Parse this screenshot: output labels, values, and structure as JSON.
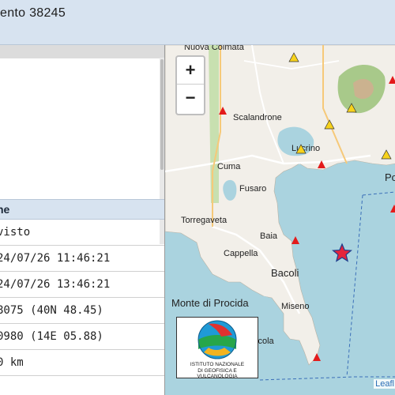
{
  "header": {
    "title": "ento 38245"
  },
  "table": {
    "header": "ne",
    "rows": [
      "visto",
      "24/07/26 11:46:21",
      "24/07/26 13:46:21",
      "8075 (40N 48.45)",
      "0980 (14E 05.88)",
      "0 km"
    ]
  },
  "map": {
    "zoom_in": "+",
    "zoom_out": "−",
    "labels": {
      "nuova_colmata": "Nuova Colmata",
      "scalandrone": "Scalandrone",
      "lucrino": "Lucrino",
      "cuma": "Cuma",
      "fusaro": "Fusaro",
      "torregaveta": "Torregaveta",
      "baia": "Baia",
      "cappella": "Cappella",
      "bacoli": "Bacoli",
      "monte_di_procida": "Monte di Procida",
      "miseno": "Miseno",
      "scola": "scola",
      "po": "Po"
    },
    "logo_line1": "ISTITUTO NAZIONALE",
    "logo_line2": "DI GEOFISICA E VULCANOLOGIA",
    "attribution": "Leafl",
    "colors": {
      "sea": "#aad3df",
      "land": "#f2efe9",
      "station_red": "#e31b1b",
      "station_yellow": "#f7d21c",
      "epicenter": "#e5243b"
    }
  }
}
